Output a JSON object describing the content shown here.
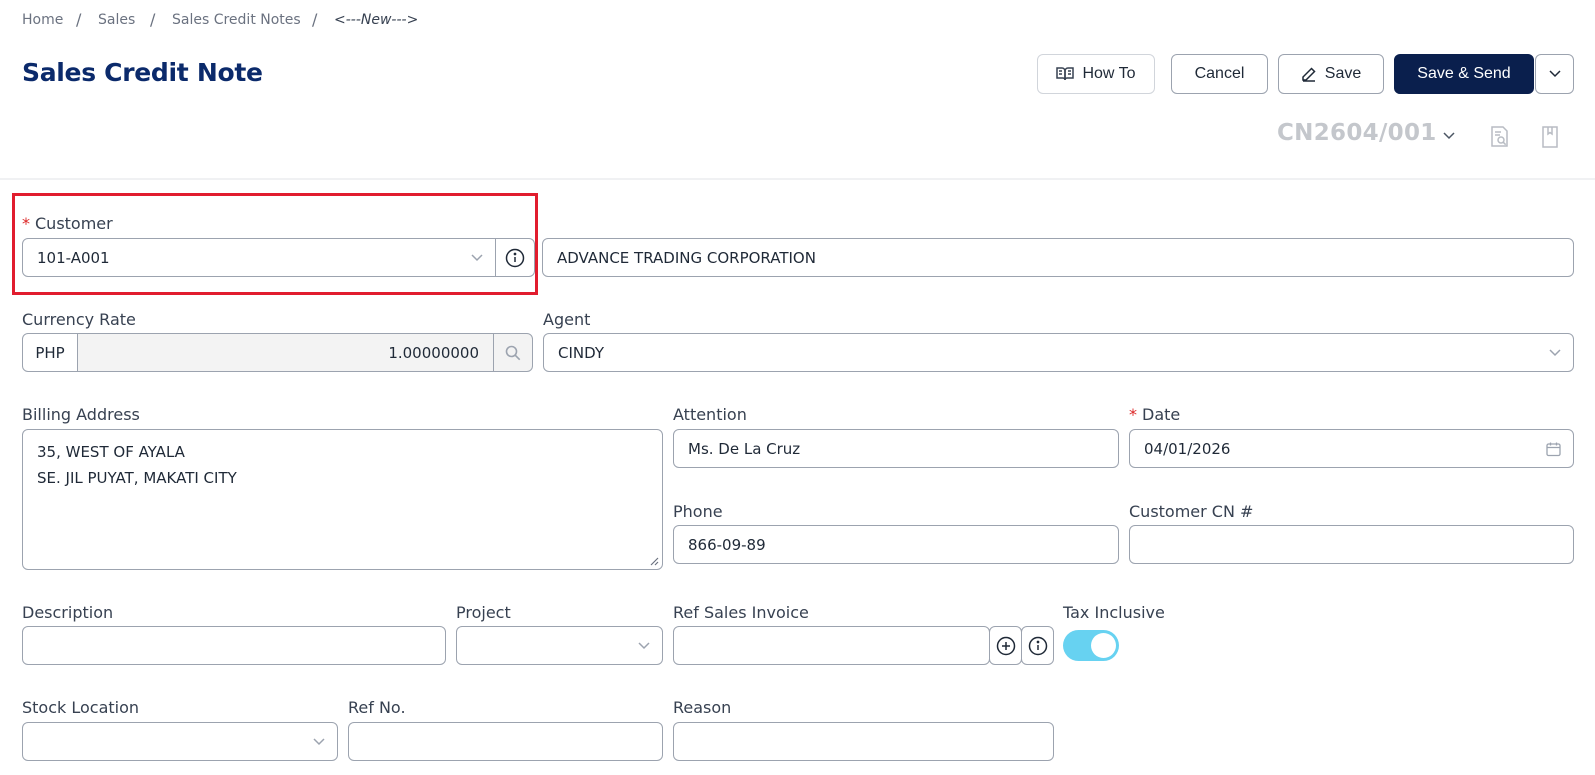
{
  "breadcrumb": {
    "items": [
      "Home",
      "Sales",
      "Sales Credit Notes"
    ],
    "current": "<---New--->"
  },
  "page_title": "Sales Credit Note",
  "toolbar": {
    "how_to_label": "How To",
    "cancel_label": "Cancel",
    "save_label": "Save",
    "save_send_label": "Save & Send"
  },
  "document_number": "CN2604/001",
  "form": {
    "customer": {
      "label": "Customer",
      "code": "101-A001",
      "name": "ADVANCE TRADING CORPORATION"
    },
    "currency_rate": {
      "label": "Currency Rate",
      "currency": "PHP",
      "rate": "1.00000000"
    },
    "agent": {
      "label": "Agent",
      "value": "CINDY"
    },
    "billing_address": {
      "label": "Billing Address",
      "line1": "35, WEST OF AYALA",
      "line2": "SE. JIL PUYAT, MAKATI CITY"
    },
    "attention": {
      "label": "Attention",
      "value": "Ms. De La Cruz"
    },
    "date": {
      "label": "Date",
      "value": "04/01/2026"
    },
    "phone": {
      "label": "Phone",
      "value": "866-09-89"
    },
    "customer_cn": {
      "label": "Customer CN #",
      "value": ""
    },
    "description": {
      "label": "Description",
      "value": ""
    },
    "project": {
      "label": "Project",
      "value": ""
    },
    "ref_sales_invoice": {
      "label": "Ref Sales Invoice",
      "value": ""
    },
    "tax_inclusive": {
      "label": "Tax Inclusive",
      "enabled": true
    },
    "stock_location": {
      "label": "Stock Location",
      "value": ""
    },
    "ref_no": {
      "label": "Ref No.",
      "value": ""
    },
    "reason": {
      "label": "Reason",
      "value": ""
    }
  },
  "colors": {
    "primary": "#0a1f4d",
    "title": "#0b2a6b",
    "required": "#dc2626",
    "highlight": "#e11d2e",
    "toggle_on": "#67d2f1"
  },
  "icons": [
    "book-icon",
    "pencil-icon",
    "chevron-down-icon",
    "info-icon",
    "search-icon",
    "calendar-icon",
    "plus-circle-icon",
    "document-search-icon",
    "bookmark-icon",
    "resize-grip-icon"
  ]
}
